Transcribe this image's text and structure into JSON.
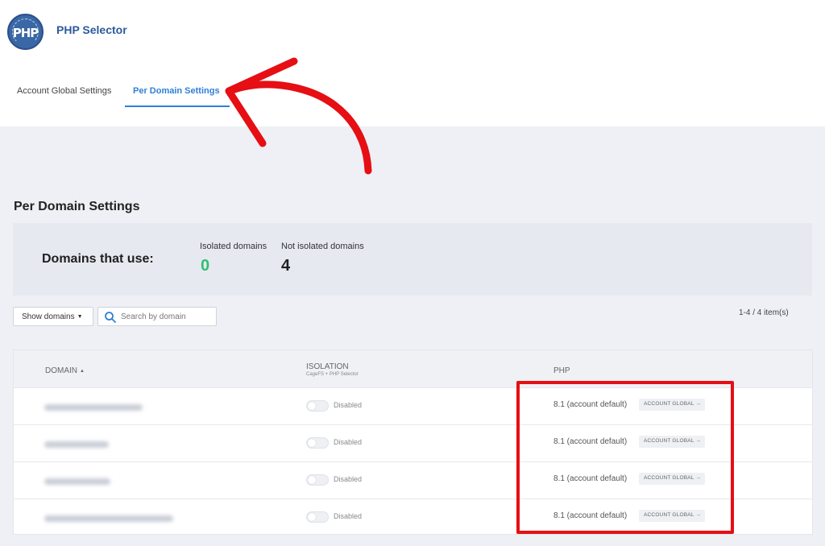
{
  "app": {
    "logo_text": "PHP",
    "title": "PHP Selector"
  },
  "tabs": [
    {
      "label": "Account Global Settings",
      "active": false
    },
    {
      "label": "Per Domain Settings",
      "active": true
    }
  ],
  "section_title": "Per Domain Settings",
  "stats": {
    "heading": "Domains that use:",
    "isolated_label": "Isolated domains",
    "isolated_value": "0",
    "not_isolated_label": "Not isolated domains",
    "not_isolated_value": "4"
  },
  "controls": {
    "show_domains_label": "Show domains",
    "search_placeholder": "Search by domain",
    "pagination": "1-4 / 4 item(s)"
  },
  "table": {
    "columns": {
      "domain": "DOMAIN",
      "isolation": "ISOLATION",
      "isolation_sub": "CageFS + PHP Selector",
      "php": "PHP"
    },
    "rows": [
      {
        "domain": "",
        "isolation": "Disabled",
        "php": "8.1 (account default)",
        "badge": "ACCOUNT GLOBAL →"
      },
      {
        "domain": "",
        "isolation": "Disabled",
        "php": "8.1 (account default)",
        "badge": "ACCOUNT GLOBAL →"
      },
      {
        "domain": "",
        "isolation": "Disabled",
        "php": "8.1 (account default)",
        "badge": "ACCOUNT GLOBAL →"
      },
      {
        "domain": "",
        "isolation": "Disabled",
        "php": "8.1 (account default)",
        "badge": "ACCOUNT GLOBAL →"
      }
    ]
  },
  "colors": {
    "accent": "#2f7fd9",
    "title": "#2c5a9b",
    "isolated_value": "#2fbf71",
    "annotation": "#e50f14"
  },
  "icons": [
    "php-logo-icon",
    "caret-down-icon",
    "search-icon",
    "sort-asc-icon",
    "arrow-annotation-icon"
  ]
}
